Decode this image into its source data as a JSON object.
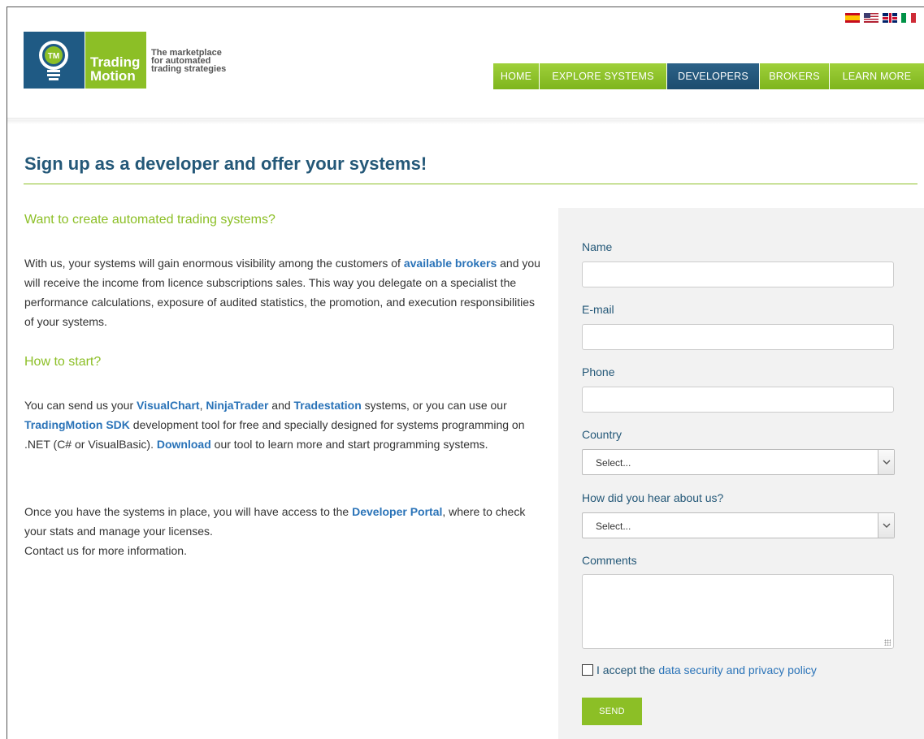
{
  "header": {
    "flags": [
      {
        "name": "spain-flag-icon"
      },
      {
        "name": "usa-flag-icon"
      },
      {
        "name": "uk-flag-icon"
      },
      {
        "name": "italy-flag-icon"
      }
    ],
    "logo": {
      "word1": "Trading",
      "word2": "Motion",
      "badge": "TM",
      "tagline": [
        "The marketplace",
        "for automated",
        "trading strategies"
      ]
    },
    "nav": {
      "home": "HOME",
      "explore": "EXPLORE SYSTEMS",
      "developers": "DEVELOPERS",
      "brokers": "BROKERS",
      "learn_more": "LEARN MORE",
      "active": "developers"
    }
  },
  "main": {
    "title": "Sign up as a developer and offer your systems!",
    "heading1": "Want to create automated trading systems?",
    "p1": {
      "t1": "With us, your systems will gain enormous visibility among the customers of ",
      "link1": "available brokers",
      "t2": " and you will receive the income from licence subscriptions sales. This way you delegate on a specialist the performance calculations, exposure of audited statistics, the promotion, and execution responsibilities of your systems."
    },
    "heading2": "How to start?",
    "p2": {
      "t1": "You can send us your ",
      "link1": "VisualChart",
      "t2": ", ",
      "link2": "NinjaTrader",
      "t3": " and ",
      "link3": "Tradestation",
      "t4": " systems, or you can use our ",
      "link4": "TradingMotion SDK",
      "t5": " development tool for free and specially designed for systems programming on .NET (C# or VisualBasic). ",
      "link5": "Download",
      "t6": " our tool to learn more and start programming systems."
    },
    "p3": {
      "t1": "Once you have the systems in place, you will have access to the ",
      "link1": "Developer Portal",
      "t2": ", where to check your stats and manage your licenses.",
      "t3": "Contact us for more information."
    }
  },
  "form": {
    "name_label": "Name",
    "name_value": "",
    "email_label": "E-mail",
    "email_value": "",
    "phone_label": "Phone",
    "phone_value": "",
    "country_label": "Country",
    "country_value": "Select...",
    "hear_label": "How did you hear about us?",
    "hear_value": "Select...",
    "comments_label": "Comments",
    "accept_text": "I accept the",
    "accept_link": "data security and privacy policy",
    "accept_checked": false,
    "send_label": "SEND"
  },
  "colors": {
    "brand_green": "#8cbf26",
    "brand_blue": "#245878",
    "link_blue": "#2a73b8"
  }
}
